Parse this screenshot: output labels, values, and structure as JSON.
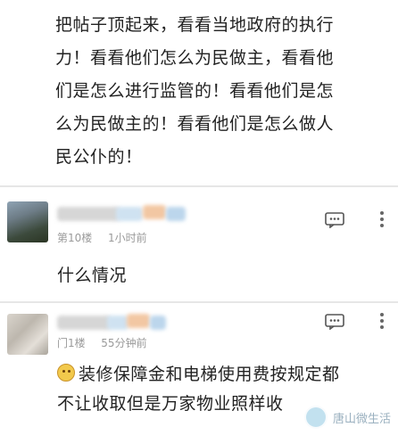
{
  "post": {
    "lines": [
      "把帖子顶起来，看看当地政府的执行",
      "力！看看他们怎么为民做主，看看他",
      "们是怎么进行监管的！看看他们是怎",
      "么为民做主的！看看他们是怎么做人",
      "民公仆的！"
    ]
  },
  "comments": [
    {
      "floor": "第10楼",
      "time": "1小时前",
      "text": "什么情况",
      "name_colors": [
        "#d8d8d8",
        "#cfe3f2",
        "#f3c9a6",
        "#bcd7ee"
      ]
    },
    {
      "floor": "门1楼",
      "time": "55分钟前",
      "text_lines": [
        "装修保障金和电梯使用费按规定都",
        "不让收取但是万家物业照样收"
      ],
      "name_colors": [
        "#d8d8d8",
        "#cfe3f2",
        "#f3c9a6",
        "#bcd7ee"
      ]
    }
  ],
  "icons": [
    "comment-reply-icon",
    "more-options-icon",
    "emoji-icon"
  ],
  "watermark": {
    "text": "唐山微生活"
  }
}
